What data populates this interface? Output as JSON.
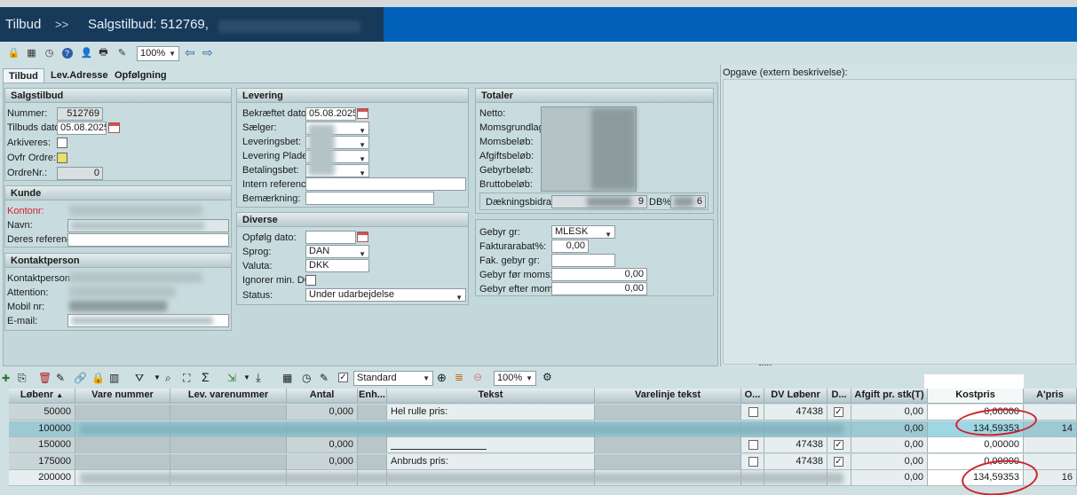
{
  "window": {
    "breadcrumb_root": "Tilbud",
    "breadcrumb_sep": ">>",
    "title": "Salgstilbud: 512769,"
  },
  "toolbar": {
    "zoom": "100%"
  },
  "tabs": [
    {
      "label": "Tilbud",
      "active": true
    },
    {
      "label": "Lev.Adresse",
      "active": false
    },
    {
      "label": "Opfølgning",
      "active": false
    }
  ],
  "salgstilbud": {
    "heading": "Salgstilbud",
    "nummer_label": "Nummer:",
    "nummer_value": "512769",
    "dato_label": "Tilbuds dato:",
    "dato_value": "05.08.2025",
    "arkiveres_label": "Arkiveres:",
    "ovfr_label": "Ovfr Ordre:",
    "ordrenr_label": "OrdreNr.:",
    "ordrenr_value": "0"
  },
  "kunde": {
    "heading": "Kunde",
    "kontonr_label": "Kontonr:",
    "navn_label": "Navn:",
    "deres_ref_label": "Deres referenc"
  },
  "kontaktperson": {
    "heading": "Kontaktperson",
    "kontaktperson_label": "Kontaktperson",
    "attention_label": "Attention:",
    "mobil_label": "Mobil nr:",
    "email_label": "E-mail:"
  },
  "levering": {
    "heading": "Levering",
    "bekraeftet_label": "Bekræftet dato:",
    "bekraeftet_value": "05.08.2025",
    "saelger_label": "Sælger:",
    "leveringsbet_label": "Leveringsbet:",
    "plader_label": "Levering Plader:",
    "betalingsbet_label": "Betalingsbet:",
    "intern_label": "Intern reference:",
    "bemaerkning_label": "Bemærkning:"
  },
  "diverse": {
    "heading": "Diverse",
    "opfolg_label": "Opfølg dato:",
    "sprog_label": "Sprog:",
    "sprog_value": "DAN",
    "valuta_label": "Valuta:",
    "valuta_value": "DKK",
    "ignorer_label": "Ignorer min. DG:",
    "status_label": "Status:",
    "status_value": "Under udarbejdelse"
  },
  "totaler": {
    "heading": "Totaler",
    "netto_label": "Netto:",
    "momsgrundlag_label": "Momsgrundlag:",
    "momsbelob_label": "Momsbeløb:",
    "afgiftsbelob_label": "Afgiftsbeløb:",
    "gebyrbelob_label": "Gebyrbeløb:",
    "bruttobelob_label": "Bruttobeløb:",
    "daekning_label": "Dækningsbidrag:",
    "daekning_value_suffix": "9",
    "db_label": "DB%:",
    "db_value_suffix": "6"
  },
  "gebyr": {
    "gebyr_gr_label": "Gebyr gr:",
    "gebyr_gr_value": "MLESK",
    "fakturarabat_label": "Fakturarabat%:",
    "fakturarabat_value": "0,00",
    "fak_gebyr_label": "Fak. gebyr gr:",
    "gebyr_for_label": "Gebyr før moms:",
    "gebyr_for_value": "0,00",
    "gebyr_efter_label": "Gebyr efter moms:",
    "gebyr_efter_value": "0,00"
  },
  "opgave": {
    "label": "Opgave (extern beskrivelse):"
  },
  "grid": {
    "layout_select": "Standard",
    "zoom": "100%",
    "columns": [
      "Løbenr",
      "Vare nummer",
      "Lev. varenummer",
      "Antal",
      "Enh...",
      "Tekst",
      "Varelinje tekst",
      "O...",
      "DV Løbenr",
      "D...",
      "Afgift pr. stk(T)",
      "Kostpris",
      "A'pris"
    ],
    "rows": [
      {
        "lobenr": "50000",
        "antal": "0,000",
        "tekst": "Hel rulle pris:",
        "dv": "47438",
        "d": true,
        "afgift": "0,00",
        "kostpris": "0,00000",
        "apris": ""
      },
      {
        "lobenr": "100000",
        "antal": "",
        "tekst": "",
        "dv": "",
        "d": false,
        "afgift": "0,00",
        "kostpris": "134,59353",
        "apris": "14"
      },
      {
        "lobenr": "150000",
        "antal": "0,000",
        "tekst": "",
        "dv": "47438",
        "d": true,
        "afgift": "0,00",
        "kostpris": "0,00000",
        "apris": ""
      },
      {
        "lobenr": "175000",
        "antal": "0,000",
        "tekst": "Anbruds pris:",
        "dv": "47438",
        "d": true,
        "afgift": "0,00",
        "kostpris": "0,00000",
        "apris": ""
      },
      {
        "lobenr": "200000",
        "antal": "",
        "tekst": "",
        "dv": "",
        "d": false,
        "afgift": "0,00",
        "kostpris": "134,59353",
        "apris": "16"
      }
    ]
  },
  "colors": {
    "title_blue": "#0160b8",
    "title_dark": "#173a5a",
    "highlight_row": "#9fd6e4",
    "annotation_red": "#d0202a"
  }
}
